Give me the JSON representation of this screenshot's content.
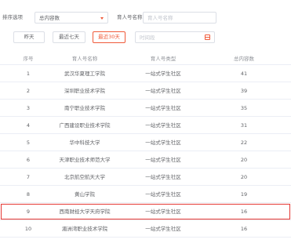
{
  "filters": {
    "sort_label": "排序选项",
    "sort_value": "总内容数",
    "name_label": "育人号名称",
    "name_placeholder": "育人号名称",
    "btn_yesterday": "昨天",
    "btn_last7": "最近七天",
    "btn_last30": "最近30天",
    "date_placeholder": "时间段"
  },
  "table": {
    "headers": [
      "序号",
      "育人号名称",
      "育人号类型",
      "总内容数"
    ],
    "rows": [
      {
        "no": "1",
        "name": "武汉华夏理工学院",
        "type": "一站式学生社区",
        "count": "41"
      },
      {
        "no": "2",
        "name": "深圳职业技术学院",
        "type": "一站式学生社区",
        "count": "39"
      },
      {
        "no": "3",
        "name": "南宁职业技术学院",
        "type": "一站式学生社区",
        "count": "35"
      },
      {
        "no": "4",
        "name": "广西建设职业技术学院",
        "type": "一站式学生社区",
        "count": "31"
      },
      {
        "no": "5",
        "name": "华中科技大学",
        "type": "一站式学生社区",
        "count": "22"
      },
      {
        "no": "6",
        "name": "天津职业技术师范大学",
        "type": "一站式学生社区",
        "count": "20"
      },
      {
        "no": "7",
        "name": "北京航空航天大学",
        "type": "一站式学生社区",
        "count": "20"
      },
      {
        "no": "8",
        "name": "黄山学院",
        "type": "一站式学生社区",
        "count": "19"
      },
      {
        "no": "9",
        "name": "西南财经大学天府学院",
        "type": "一站式学生社区",
        "count": "16"
      },
      {
        "no": "10",
        "name": "湄洲湾职业技术学院",
        "type": "一站式学生社区",
        "count": "16"
      }
    ]
  },
  "colors": {
    "accent": "#f05a3a",
    "highlight_border": "#e53935"
  }
}
